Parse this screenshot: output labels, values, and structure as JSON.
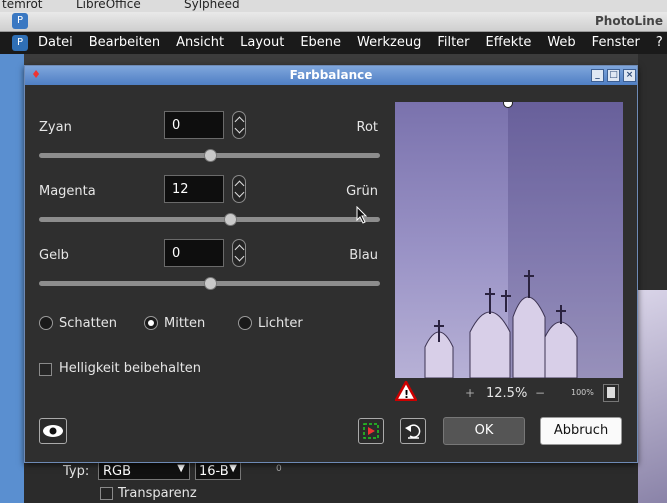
{
  "desktop": {
    "taskbar_items": [
      "temrot",
      "LibreOffice",
      "Sylpheed"
    ]
  },
  "app": {
    "title": "PhotoLine",
    "menu": [
      "Datei",
      "Bearbeiten",
      "Ansicht",
      "Layout",
      "Ebene",
      "Werkzeug",
      "Filter",
      "Effekte",
      "Web",
      "Fenster",
      "?"
    ]
  },
  "dialog": {
    "title": "Farbbalance",
    "sliders": [
      {
        "left": "Zyan",
        "right": "Rot",
        "value": "0",
        "fraction": 0.5
      },
      {
        "left": "Magenta",
        "right": "Grün",
        "value": "12",
        "fraction": 0.56
      },
      {
        "left": "Gelb",
        "right": "Blau",
        "value": "0",
        "fraction": 0.5
      }
    ],
    "ranges": [
      {
        "label": "Schatten",
        "selected": false
      },
      {
        "label": "Mitten",
        "selected": true
      },
      {
        "label": "Lichter",
        "selected": false
      }
    ],
    "preserve_luminosity": {
      "label": "Helligkeit beibehalten",
      "checked": false
    },
    "zoom": {
      "plus": "+",
      "value": "12.5%",
      "minus": "−",
      "fit": "100%"
    },
    "buttons": {
      "ok": "OK",
      "cancel": "Abbruch"
    }
  },
  "bottom_panel": {
    "type_label": "Typ:",
    "type_value": "RGB",
    "depth_value": "16-B",
    "transparency_label": "Transparenz",
    "ruler_tick": "0"
  },
  "colors": {
    "dialog_title": "#5b87c9",
    "dialog_bg": "#2f2f2f",
    "menu_bg": "#1a1a1a"
  }
}
